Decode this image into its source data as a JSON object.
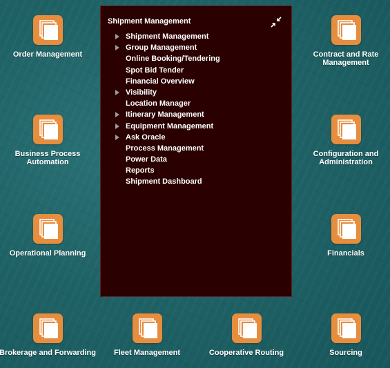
{
  "colors": {
    "tile_icon": "#e68d3e",
    "panel_bg": "#2a0000",
    "background": "#1f6266",
    "arrow": "#9a9a9a"
  },
  "tiles": [
    {
      "label": "Order Management",
      "icon": "stacked-pages-icon"
    },
    {
      "label": "Contract and Rate\nManagement",
      "icon": "stacked-pages-icon"
    },
    {
      "label": "Business Process\nAutomation",
      "icon": "stacked-pages-icon"
    },
    {
      "label": "Configuration and\nAdministration",
      "icon": "stacked-pages-icon"
    },
    {
      "label": "Operational Planning",
      "icon": "stacked-pages-icon"
    },
    {
      "label": "Financials",
      "icon": "stacked-pages-icon"
    },
    {
      "label": "Brokerage and Forwarding",
      "icon": "stacked-pages-icon"
    },
    {
      "label": "Fleet Management",
      "icon": "stacked-pages-icon"
    },
    {
      "label": "Cooperative Routing",
      "icon": "stacked-pages-icon"
    },
    {
      "label": "Sourcing",
      "icon": "stacked-pages-icon"
    }
  ],
  "panel": {
    "title": "Shipment Management",
    "collapse_icon": "collapse-arrows-icon",
    "items": [
      {
        "label": "Shipment Management",
        "expandable": true
      },
      {
        "label": "Group Management",
        "expandable": true
      },
      {
        "label": "Online Booking/Tendering",
        "expandable": false
      },
      {
        "label": "Spot Bid Tender",
        "expandable": false
      },
      {
        "label": "Financial Overview",
        "expandable": false
      },
      {
        "label": "Visibility",
        "expandable": true
      },
      {
        "label": "Location Manager",
        "expandable": false
      },
      {
        "label": "Itinerary Management",
        "expandable": true
      },
      {
        "label": "Equipment Management",
        "expandable": true
      },
      {
        "label": "Ask Oracle",
        "expandable": true
      },
      {
        "label": "Process Management",
        "expandable": false
      },
      {
        "label": "Power Data",
        "expandable": false
      },
      {
        "label": "Reports",
        "expandable": false
      },
      {
        "label": "Shipment Dashboard",
        "expandable": false
      }
    ]
  }
}
